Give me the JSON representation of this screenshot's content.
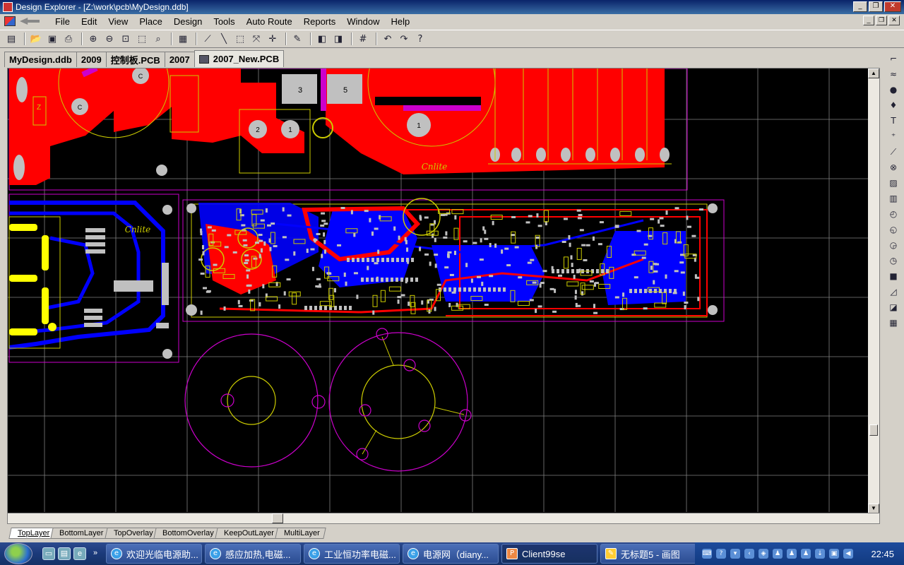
{
  "window": {
    "title": "Design Explorer - [Z:\\work\\pcb\\MyDesign.ddb]"
  },
  "menu": {
    "items": [
      "File",
      "Edit",
      "View",
      "Place",
      "Design",
      "Tools",
      "Auto Route",
      "Reports",
      "Window",
      "Help"
    ]
  },
  "doc_tabs": [
    {
      "label": "MyDesign.ddb",
      "active": false
    },
    {
      "label": "2009",
      "active": false
    },
    {
      "label": "控制板.PCB",
      "active": false
    },
    {
      "label": "2007",
      "active": false
    },
    {
      "label": "2007_New.PCB",
      "active": true
    }
  ],
  "pcb": {
    "pad_labels": [
      "3",
      "5",
      "2",
      "1",
      "1",
      "C",
      "C",
      "Z"
    ],
    "logo_text": "Cnlite"
  },
  "layer_tabs": [
    {
      "label": "TopLayer",
      "active": true
    },
    {
      "label": "BottomLayer",
      "active": false
    },
    {
      "label": "TopOverlay",
      "active": false
    },
    {
      "label": "BottomOverlay",
      "active": false
    },
    {
      "label": "KeepOutLayer",
      "active": false
    },
    {
      "label": "MultiLayer",
      "active": false
    }
  ],
  "taskbar": {
    "buttons": [
      {
        "label": "欢迎光临电源助..."
      },
      {
        "label": "感应加热,电磁..."
      },
      {
        "label": "工业恒功率电磁..."
      },
      {
        "label": "电源网（diany..."
      },
      {
        "label": "Client99se"
      },
      {
        "label": "无标题5 - 画图"
      }
    ],
    "clock": "22:45"
  },
  "colors": {
    "top_layer": "#ff0000",
    "bottom_layer": "#0000ff",
    "overlay": "#ffff00",
    "keepout": "#ff00ff",
    "pads": "#c0c0c0",
    "grid": "#808080",
    "background": "#000000"
  }
}
